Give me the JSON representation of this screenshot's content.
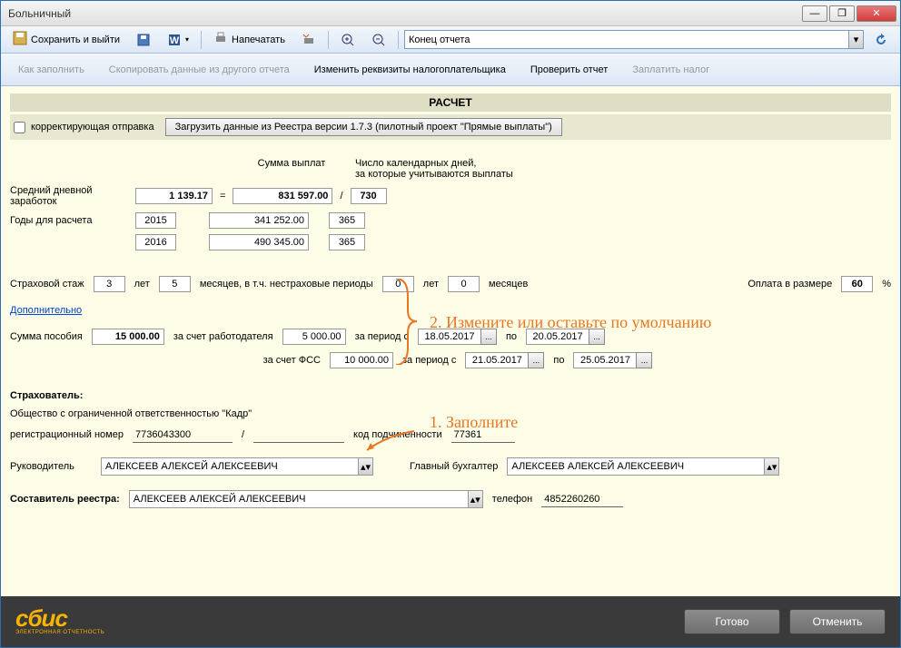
{
  "window": {
    "title": "Больничный"
  },
  "win_btns": {
    "min": "—",
    "max": "❐",
    "close": "✕"
  },
  "toolbar1": {
    "save_exit": "Сохранить и выйти",
    "print": "Напечатать",
    "combo_value": "Конец отчета"
  },
  "toolbar2": {
    "how_fill": "Как заполнить",
    "copy_data": "Скопировать данные из другого отчета",
    "change_req": "Изменить реквизиты налогоплательщика",
    "check_report": "Проверить отчет",
    "pay_tax": "Заплатить налог"
  },
  "section": "РАСЧЕТ",
  "corr": {
    "checkbox_label": "корректирующая отправка",
    "load_btn": "Загрузить данные из Реестра версии 1.7.3 (пилотный проект \"Прямые выплаты\")"
  },
  "headers": {
    "sum": "Сумма выплат",
    "days": "Число календарных дней,\nза которые учитываются выплаты"
  },
  "avg": {
    "label": "Средний дневной заработок",
    "value": "1 139.17",
    "eq": "=",
    "total": "831 597.00",
    "div": "/",
    "days": "730"
  },
  "years": {
    "label": "Годы для расчета",
    "y1": "2015",
    "s1": "341 252.00",
    "d1": "365",
    "y2": "2016",
    "s2": "490 345.00",
    "d2": "365"
  },
  "stazh": {
    "label": "Страховой стаж",
    "yrs": "3",
    "yrs_l": "лет",
    "mon": "5",
    "mon_l": "месяцев, в т.ч. нестраховые периоды",
    "ny": "0",
    "ny_l": "лет",
    "nm": "0",
    "nm_l": "месяцев",
    "pay_l": "Оплата в размере",
    "pay_v": "60",
    "pct": "%"
  },
  "link_more": "Дополнительно",
  "benefit": {
    "sum_label": "Сумма пособия",
    "sum_v": "15 000.00",
    "employer_l": "за счет работодателя",
    "employer_v": "5 000.00",
    "period_from_l": "за период с",
    "d1": "18.05.2017",
    "to_l": "по",
    "d2": "20.05.2017",
    "fss_l": "за счет ФСС",
    "fss_v": "10 000.00",
    "d3": "21.05.2017",
    "d4": "25.05.2017"
  },
  "insurer": {
    "title": "Страхователь:",
    "org": "Общество с ограниченной ответственностью \"Кадр\"",
    "reg_l": "регистрационный номер",
    "reg_v": "7736043300",
    "slash": "/",
    "sub_l": "код подчиненности",
    "sub_v": "77361",
    "head_l": "Руководитель",
    "head_v": "АЛЕКСЕЕВ АЛЕКСЕЙ АЛЕКСЕЕВИЧ",
    "acc_l": "Главный бухгалтер",
    "acc_v": "АЛЕКСЕЕВ АЛЕКСЕЙ АЛЕКСЕЕВИЧ",
    "comp_l": "Составитель реестра:",
    "comp_v": "АЛЕКСЕЕВ АЛЕКСЕЙ АЛЕКСЕЕВИЧ",
    "phone_l": "телефон",
    "phone_v": "4852260260"
  },
  "footer": {
    "logo": "сбис",
    "logo_sub": "ЭЛЕКТРОННАЯ ОТЧЕТНОСТЬ",
    "ok": "Готово",
    "cancel": "Отменить"
  },
  "annotations": {
    "a1": "1. Заполните",
    "a2": "2. Измените или оставьте по умолчанию"
  }
}
